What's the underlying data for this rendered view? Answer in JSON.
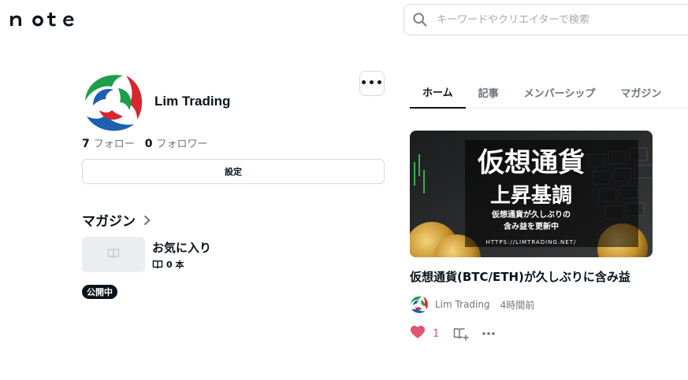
{
  "header": {
    "logo_text": "note",
    "search_placeholder": "キーワードやクリエイターで検索",
    "search_value": ""
  },
  "profile": {
    "name": "Lim Trading",
    "follow_count": "7",
    "follow_label": "フォロー",
    "follower_count": "0",
    "follower_label": "フォロワー",
    "settings_label": "設定",
    "more_label": "•••"
  },
  "magazine": {
    "heading": "マガジン",
    "item_title": "お気に入り",
    "item_count": "0 本",
    "status_badge": "公開中"
  },
  "tabs": [
    {
      "label": "ホーム",
      "active": true
    },
    {
      "label": "記事",
      "active": false
    },
    {
      "label": "メンバーシップ",
      "active": false
    },
    {
      "label": "マガジン",
      "active": false
    }
  ],
  "article": {
    "thumbnail": {
      "headline": "仮想通貨",
      "subheadline": "上昇基調",
      "caption_line1": "仮想通貨が久しぶりの",
      "caption_line2": "含み益を更新中",
      "url_text": "HTTPS://LIMTRADING.NET/"
    },
    "title": "仮想通貨(BTC/ETH)が久しぶりに含み益",
    "author": "Lim Trading",
    "time": "4時間前",
    "like_count": "1"
  },
  "colors": {
    "text": "#08131a",
    "muted": "#6e7478",
    "border": "#d6d9dc",
    "like": "#e05570",
    "logo_green": "#1e9e4a",
    "logo_red": "#d7262e",
    "logo_blue": "#1d5fb0"
  },
  "icons": [
    "search-icon",
    "chevron-right-icon",
    "book-icon",
    "heart-icon",
    "add-to-magazine-icon",
    "more-icon"
  ]
}
